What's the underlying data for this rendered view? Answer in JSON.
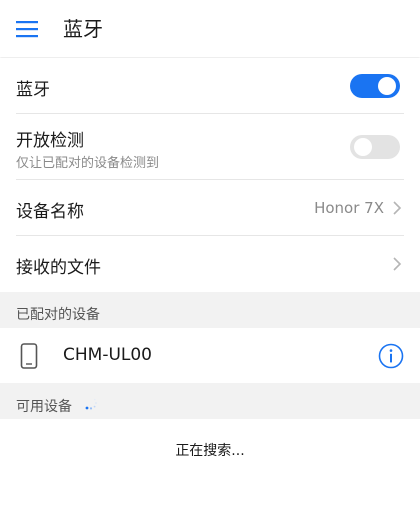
{
  "header": {
    "title": "蓝牙",
    "menu_icon": "hamburger-menu-icon",
    "accent_color": "#1a74f2"
  },
  "settings": {
    "bluetooth": {
      "label": "蓝牙",
      "toggle_on": true
    },
    "discoverable": {
      "label": "开放检测",
      "sublabel": "仅让已配对的设备检测到",
      "toggle_on": false
    },
    "device_name": {
      "label": "设备名称",
      "value": "Honor 7X"
    },
    "received_files": {
      "label": "接收的文件"
    }
  },
  "paired_section": {
    "title": "已配对的设备",
    "devices": [
      {
        "name": "CHM-UL00",
        "icon": "phone-icon",
        "action_icon": "info-icon"
      }
    ]
  },
  "available_section": {
    "title": "可用设备",
    "status_icon": "loading-spinner-icon",
    "status_text": "正在搜索..."
  }
}
